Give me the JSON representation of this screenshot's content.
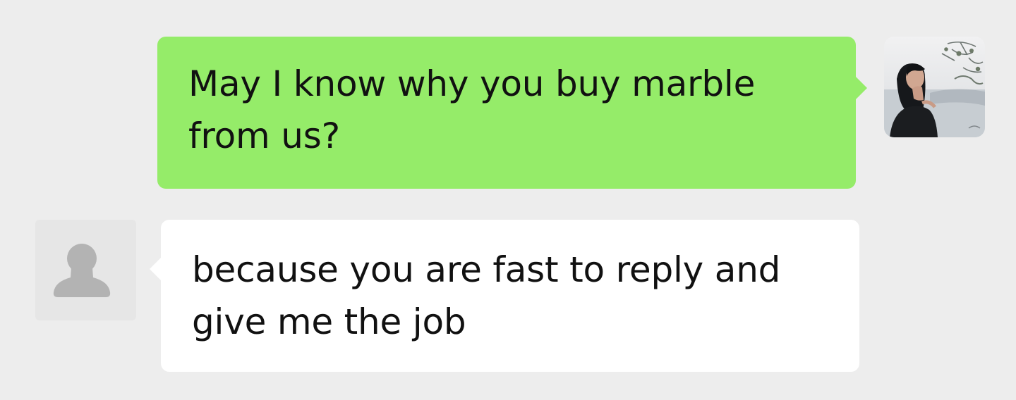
{
  "conversation": {
    "messages": [
      {
        "direction": "sent",
        "text": "May I know why you buy marble from us?",
        "avatar_icon": "woman-photo-avatar"
      },
      {
        "direction": "received",
        "text": "because you are fast to reply and give me the job",
        "avatar_icon": "default-person-avatar"
      }
    ]
  },
  "colors": {
    "background": "#ededed",
    "sent_bubble": "#95ec69",
    "received_bubble": "#ffffff",
    "text": "#111111",
    "default_avatar_background": "#e6e6e6",
    "default_avatar_icon": "#b3b3b3"
  }
}
